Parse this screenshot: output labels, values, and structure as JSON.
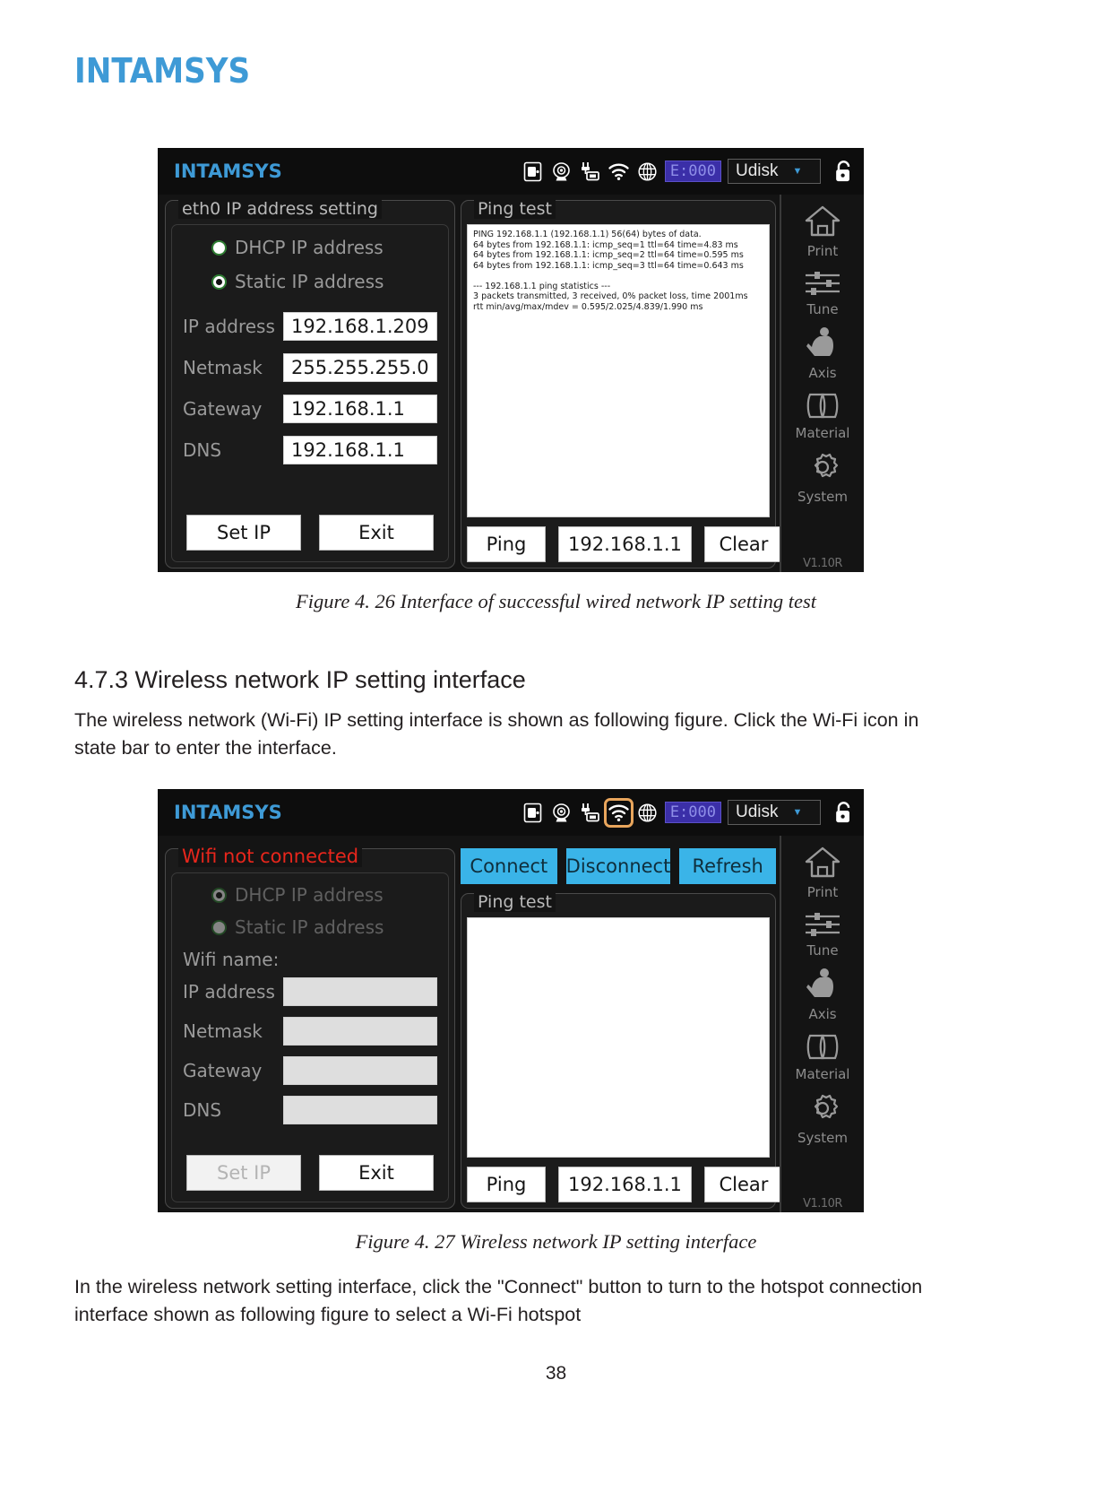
{
  "brand": {
    "wordmark": "INTAMSYS"
  },
  "figure1": {
    "topbar": {
      "logo": "INTAMSYS",
      "icons": [
        "door-lock-icon",
        "camera-icon",
        "ethernet-icon",
        "wifi-icon",
        "globe-icon"
      ],
      "error_code": "E:000",
      "storage_label": "Udisk",
      "caret": "▼",
      "lock": "unlock-icon"
    },
    "left_panel": {
      "title": "eth0 IP address setting",
      "radio_dhcp": "DHCP IP address",
      "radio_static": "Static IP address",
      "fields": [
        {
          "label": "IP address",
          "value": "192.168.1.209"
        },
        {
          "label": "Netmask",
          "value": "255.255.255.0"
        },
        {
          "label": "Gateway",
          "value": "192.168.1.1"
        },
        {
          "label": "DNS",
          "value": "192.168.1.1"
        }
      ],
      "set_ip": "Set IP",
      "exit": "Exit"
    },
    "right_panel": {
      "title": "Ping test",
      "output": "PING 192.168.1.1 (192.168.1.1) 56(64) bytes of data.\n64 bytes from 192.168.1.1: icmp_seq=1 ttl=64 time=4.83 ms\n64 bytes from 192.168.1.1: icmp_seq=2 ttl=64 time=0.595 ms\n64 bytes from 192.168.1.1: icmp_seq=3 ttl=64 time=0.643 ms\n\n--- 192.168.1.1 ping statistics ---\n3 packets transmitted, 3 received, 0% packet loss, time 2001ms\nrtt min/avg/max/mdev = 0.595/2.025/4.839/1.990 ms",
      "ping_button": "Ping",
      "ping_target": "192.168.1.1",
      "clear_button": "Clear"
    },
    "sidebar": {
      "items": [
        {
          "label": "Print",
          "icon": "home-icon"
        },
        {
          "label": "Tune",
          "icon": "sliders-icon"
        },
        {
          "label": "Axis",
          "icon": "hand-axis-icon"
        },
        {
          "label": "Material",
          "icon": "filament-spool-icon"
        },
        {
          "label": "System",
          "icon": "gear-icon"
        }
      ],
      "version": "V1.10R"
    }
  },
  "figure2": {
    "topbar": {
      "logo": "INTAMSYS",
      "error_code": "E:000",
      "storage_label": "Udisk",
      "caret": "▼",
      "lock": "unlock-icon"
    },
    "left_panel": {
      "status": "Wifi not connected",
      "radio_dhcp": "DHCP IP address",
      "radio_static": "Static IP address",
      "wifi_name_label": "Wifi name:",
      "fields": [
        {
          "label": "IP address",
          "value": ""
        },
        {
          "label": "Netmask",
          "value": ""
        },
        {
          "label": "Gateway",
          "value": ""
        },
        {
          "label": "DNS",
          "value": ""
        }
      ],
      "set_ip": "Set IP",
      "exit": "Exit"
    },
    "actions": {
      "connect": "Connect",
      "disconnect": "Disconnect",
      "refresh": "Refresh"
    },
    "right_panel": {
      "title": "Ping test",
      "output": "",
      "ping_button": "Ping",
      "ping_target": "192.168.1.1",
      "clear_button": "Clear"
    },
    "sidebar": {
      "items": [
        {
          "label": "Print",
          "icon": "home-icon"
        },
        {
          "label": "Tune",
          "icon": "sliders-icon"
        },
        {
          "label": "Axis",
          "icon": "hand-axis-icon"
        },
        {
          "label": "Material",
          "icon": "filament-spool-icon"
        },
        {
          "label": "System",
          "icon": "gear-icon"
        }
      ],
      "version": "V1.10R"
    }
  },
  "document": {
    "caption1": "Figure 4. 26 Interface of successful wired network IP setting test",
    "section_heading": "4.7.3 Wireless network IP setting interface",
    "paragraph1": "The wireless network (Wi-Fi) IP setting interface is shown as following figure. Click the Wi-Fi icon in state bar to enter the interface.",
    "caption2": "Figure 4. 27 Wireless network IP setting interface",
    "paragraph2": "In the wireless network setting interface, click the \"Connect\" button to turn to the hotspot connection interface shown as following figure to select a Wi-Fi hotspot",
    "page_number": "38"
  },
  "colors": {
    "brand_blue": "#3e9ad6",
    "accent_cyan": "#3ab4e8",
    "error_red": "#e8261c",
    "highlight_orange": "#e8a55c",
    "badge_purple": "#3b2fa8"
  }
}
